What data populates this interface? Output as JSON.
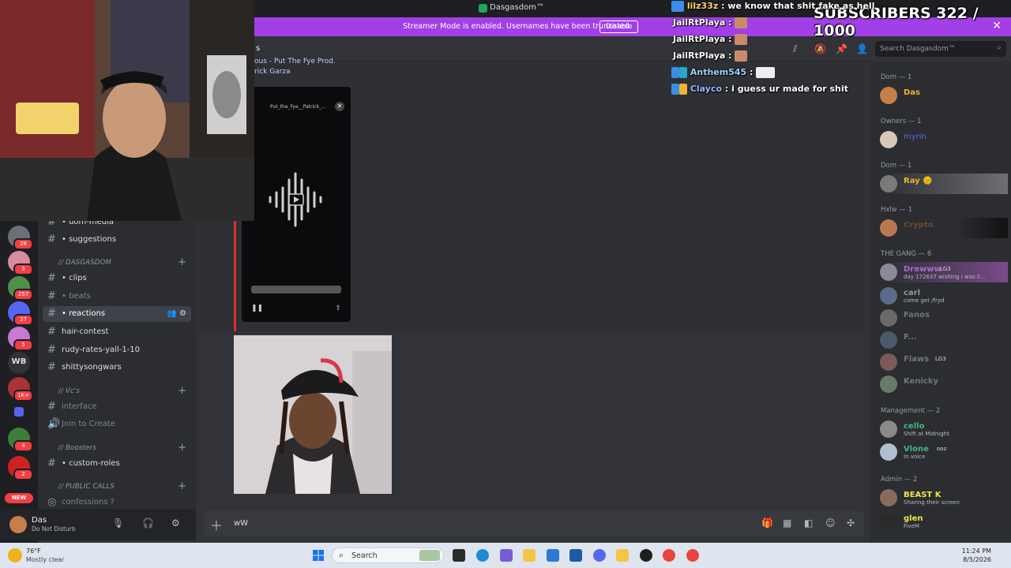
{
  "window": {
    "title": "Dasgasdom™"
  },
  "banner": {
    "message": "Streamer Mode is enabled. Usernames have been truncated.",
    "button": "Disable",
    "close": "✕"
  },
  "overlay": {
    "subscribers": "SUBSCRIBERS 322 / 1000",
    "chat": [
      {
        "user": "lilz33z",
        "text": " : we know that shit fake as hell",
        "color": "#ffd36b"
      },
      {
        "user": "JailRtPlaya",
        "text": " :",
        "color": "#ffffff"
      },
      {
        "user": "JailRtPlaya",
        "text": " :",
        "color": "#ffffff"
      },
      {
        "user": "JailRtPlaya",
        "text": " :",
        "color": "#ffffff"
      },
      {
        "user": "Anthem545",
        "text": " :",
        "color": "#9fd3ff"
      },
      {
        "user": "Clayco",
        "text": " : i guess ur made for shit",
        "color": "#9fb8ff"
      }
    ]
  },
  "servers": [
    {
      "badge": "28",
      "color": "#6b6f78"
    },
    {
      "badge": "3",
      "color": "#d88aa0"
    },
    {
      "badge": "257",
      "color": "#4f8f4a"
    },
    {
      "badge": "37",
      "color": "#5865f2"
    },
    {
      "badge": "5",
      "color": "#c57bd2"
    },
    {
      "label": "WB",
      "color": "#313338"
    },
    {
      "badge": "1K+",
      "color": "#a33"
    },
    {
      "label": "",
      "color": "#5865f2"
    },
    {
      "badge": "4",
      "color": "#3f7d3a"
    },
    {
      "badge": "2",
      "color": "#c22"
    }
  ],
  "new_pill": "NEW",
  "channels": [
    {
      "type": "text",
      "label": "• dom-media"
    },
    {
      "type": "text",
      "label": "• suggestions"
    },
    {
      "type": "category",
      "label": "// DASGASDOM"
    },
    {
      "type": "text",
      "label": "• clips"
    },
    {
      "type": "text",
      "label": "• beats",
      "muted": true
    },
    {
      "type": "text",
      "label": "• reactions",
      "active": true
    },
    {
      "type": "text",
      "label": "hair-contest"
    },
    {
      "type": "text",
      "label": "rudy-rates-yall-1-10"
    },
    {
      "type": "text",
      "label": "shittysongwars"
    },
    {
      "type": "category",
      "label": "// Vc's"
    },
    {
      "type": "text",
      "label": "interface",
      "muted": true
    },
    {
      "type": "voice",
      "label": "Join to Create",
      "muted": true
    },
    {
      "type": "category",
      "label": "// Boosters"
    },
    {
      "type": "text",
      "label": "• custom-roles"
    },
    {
      "type": "category",
      "label": "// PUBLIC CALLS"
    },
    {
      "type": "voice",
      "label": "confessions ?",
      "muted": true
    }
  ],
  "user": {
    "name": "Das",
    "status": "Do Not Disturb"
  },
  "header": {
    "channel": "s",
    "search_placeholder": "Search Dasgasdom™"
  },
  "attachment": {
    "title_lines": [
      "ous - Put The Fye Prod.",
      "rick Garza"
    ],
    "file_name": "Put_the_Fye__Patrick_..."
  },
  "composer": {
    "value": "wW"
  },
  "member_groups": [
    {
      "title": "Dom — 1",
      "members": [
        {
          "name": "Das",
          "color": "#f0b232",
          "av": "#c77f4a"
        }
      ]
    },
    {
      "title": "Owners — 1",
      "members": [
        {
          "name": "myrin",
          "color": "#5865f2",
          "av": "#d8c8b8"
        }
      ]
    },
    {
      "title": "Dom — 1",
      "members": [
        {
          "name": "Ray 🌞",
          "color": "#f0b232",
          "av": "#7a7a7a"
        }
      ]
    },
    {
      "title": "Hxlw — 1",
      "members": [
        {
          "name": "Crypto",
          "color": "#6b4a2a",
          "av": "#b87850"
        }
      ]
    },
    {
      "title": "THE GANG — 6",
      "members": [
        {
          "name": "Drewww",
          "color": "#a86bd0",
          "av": "#8a8a9a",
          "tag": "LG3",
          "sub": "day 172637 wishing i was li..."
        },
        {
          "name": "carl",
          "color": "#8f95a0",
          "av": "#5c6b8a",
          "sub": "come get /fryd"
        },
        {
          "name": "Fanos",
          "color": "#6f7580",
          "av": "#6a6a6a"
        },
        {
          "name": "F...",
          "color": "#6f7580",
          "av": "#4a5a6a"
        },
        {
          "name": "Flaws",
          "color": "#6f7580",
          "av": "#7a5a5a",
          "tag": "LG3"
        },
        {
          "name": "Kenicky",
          "color": "#6f7580",
          "av": "#6a7a6a"
        }
      ]
    },
    {
      "title": "Management — 2",
      "members": [
        {
          "name": "cello",
          "color": "#43b581",
          "av": "#8a8a8a",
          "sub": "Shift at Midnight"
        },
        {
          "name": "Vlone",
          "color": "#43b581",
          "av": "#b0c0d0",
          "tag": "ooz",
          "sub": "In voice"
        }
      ]
    },
    {
      "title": "Admin — 2",
      "members": [
        {
          "name": "BEAST K",
          "color": "#f0e44a",
          "av": "#8a6a5a",
          "sub": "Sharing their screen"
        },
        {
          "name": "glen",
          "color": "#f0e44a",
          "av": "#2a2a2a",
          "sub": "FiveM"
        }
      ]
    }
  ],
  "taskbar": {
    "temp": "76°F",
    "weather": "Mostly clear",
    "search": "Search",
    "time": "11:24 PM",
    "date": "8/5/2026"
  }
}
